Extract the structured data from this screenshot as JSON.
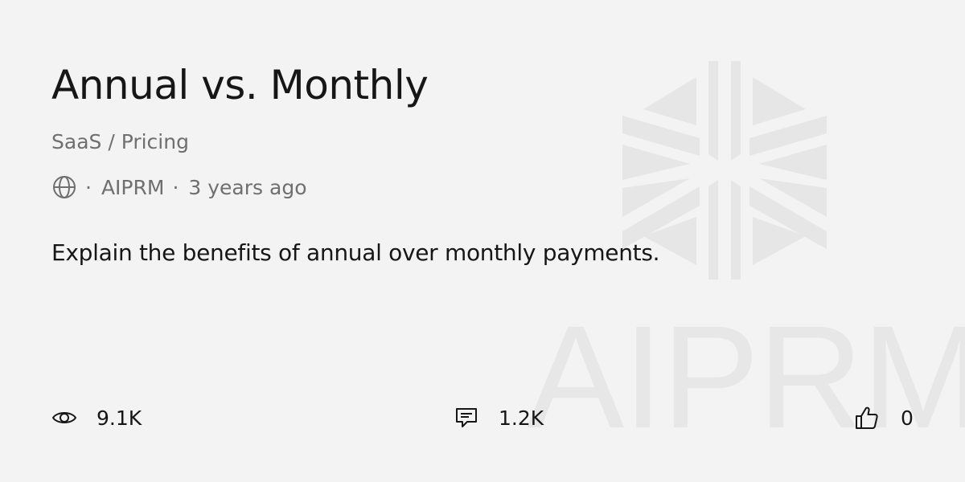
{
  "prompt": {
    "title": "Annual vs. Monthly",
    "category": "SaaS / Pricing",
    "separator": "·",
    "author": "AIPRM",
    "age": "3 years ago",
    "description": "Explain the benefits of annual over monthly payments."
  },
  "stats": {
    "views": "9.1K",
    "comments": "1.2K",
    "likes": "0"
  },
  "watermark": {
    "text": "AIPRM"
  },
  "icons": {
    "visibility": "globe-icon",
    "views": "eye-icon",
    "comments": "comment-icon",
    "likes": "thumbs-up-icon",
    "logo": "aiprm-logo-icon"
  },
  "colors": {
    "background": "#f3f3f3",
    "text": "#161616",
    "muted": "#6f6f6f",
    "watermark": "#e7e7e7"
  }
}
